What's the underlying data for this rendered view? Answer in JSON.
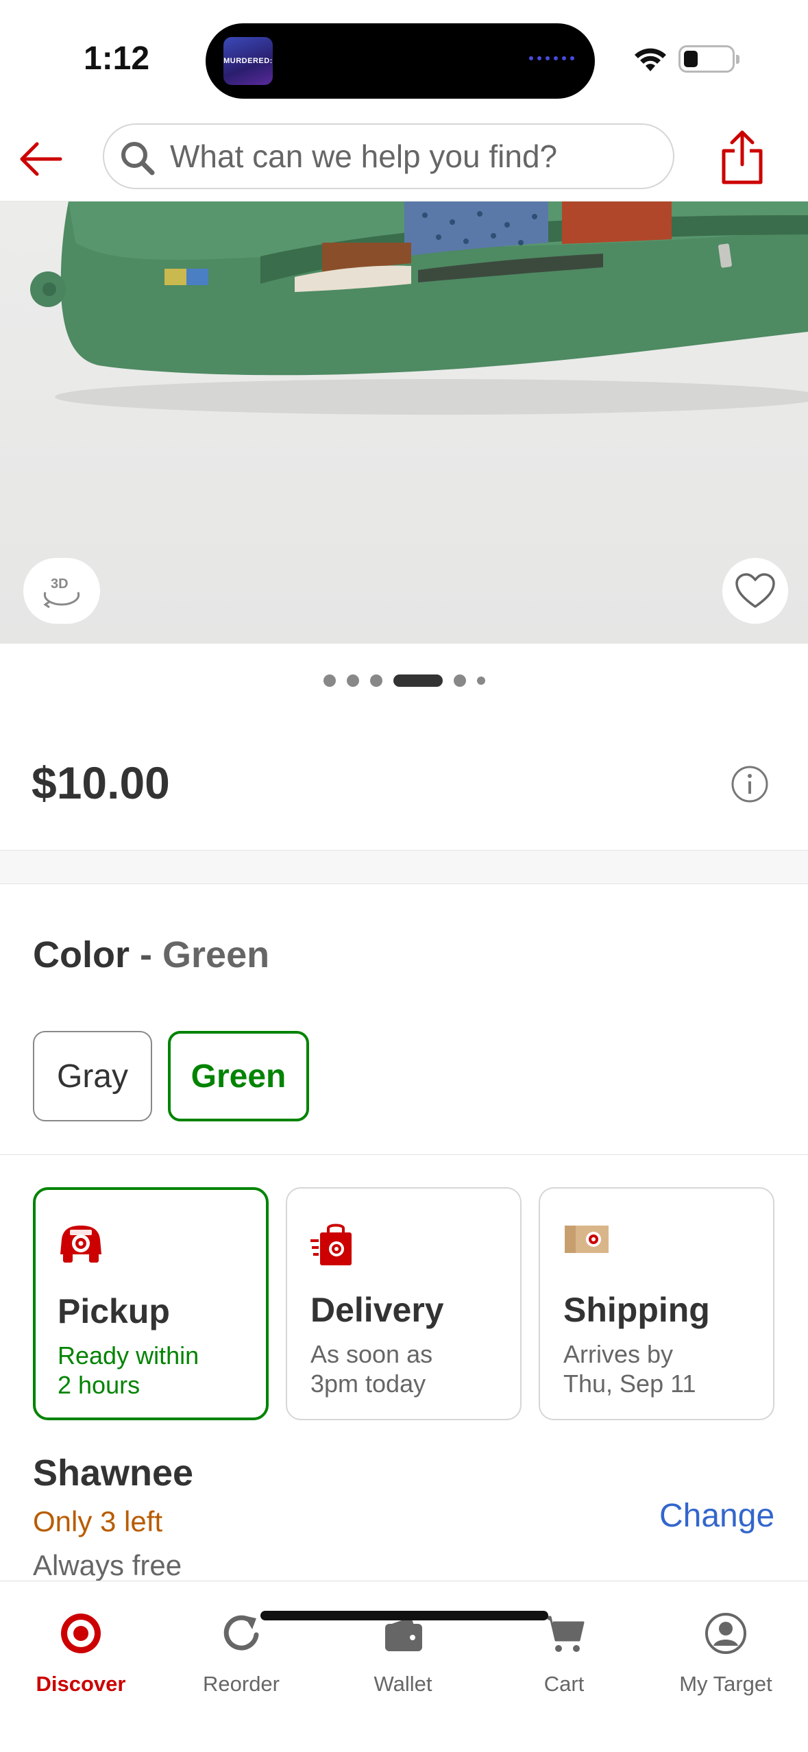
{
  "status_bar": {
    "time": "1:12",
    "now_playing_art_text": "MURDERED:"
  },
  "header": {
    "search_placeholder": "What can we help you find?"
  },
  "product": {
    "carousel": {
      "total_images": 6,
      "active_index": 3
    },
    "price": "$10.00",
    "color_label": "Color",
    "color_separator": "-",
    "selected_color": "Green",
    "color_options": [
      "Gray",
      "Green"
    ]
  },
  "fulfillment": {
    "pickup": {
      "title": "Pickup",
      "line1": "Ready within",
      "line2": "2 hours"
    },
    "delivery": {
      "title": "Delivery",
      "line1": "As soon as",
      "line2": "3pm today"
    },
    "shipping": {
      "title": "Shipping",
      "line1": "Arrives by",
      "line2": "Thu, Sep 11"
    }
  },
  "store": {
    "name": "Shawnee",
    "stock": "Only 3 left",
    "cost": "Always free",
    "change_label": "Change"
  },
  "tabs": [
    {
      "label": "Discover",
      "icon": "target-bullseye-icon",
      "active": true
    },
    {
      "label": "Reorder",
      "icon": "reorder-icon",
      "active": false
    },
    {
      "label": "Wallet",
      "icon": "wallet-icon",
      "active": false
    },
    {
      "label": "Cart",
      "icon": "cart-icon",
      "active": false
    },
    {
      "label": "My Target",
      "icon": "account-icon",
      "active": false
    }
  ],
  "colors": {
    "brand_red": "#cc0000",
    "selected_green": "#008300",
    "stock_orange": "#b85c00",
    "link_blue": "#3366cc"
  }
}
